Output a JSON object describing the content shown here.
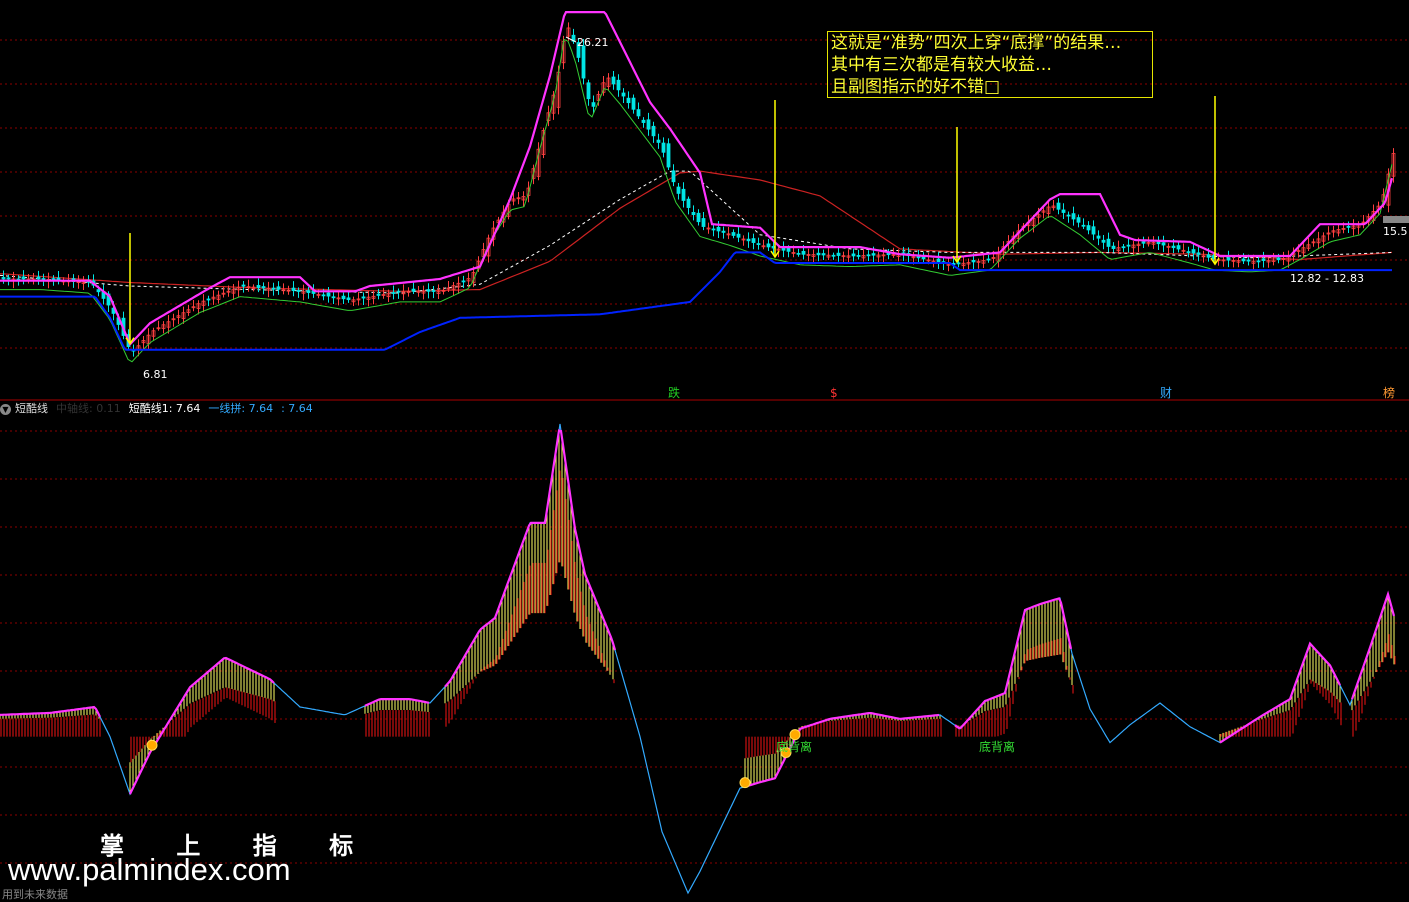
{
  "annotation": {
    "lines": [
      "这就是“准势”四次上穿“底撑”的结果…",
      "其中有三次都是有较大收益…",
      "且副图指示的好不错□"
    ]
  },
  "main_labels": {
    "high_value": "26.21",
    "low_value": "6.81",
    "right_value": "15.5",
    "range_text": "12.82 - 12.83"
  },
  "signals": [
    {
      "text": "跌",
      "color": "#22cc22"
    },
    {
      "text": "$",
      "color": "#ff3333"
    },
    {
      "text": "财",
      "color": "#33aaff"
    },
    {
      "text": "榜",
      "color": "#ff9933"
    }
  ],
  "sub_header": {
    "name": "短酷线",
    "faded": "中轴线: 0.11",
    "line1": "短酷线1: 7.64",
    "line2": "一线拼: 7.64",
    "line3": ": 7.64"
  },
  "sub_labels": {
    "divergence1": "底背离",
    "divergence2": "底背离"
  },
  "watermark": {
    "cn": "掌 上 指 标",
    "url": "www.palmindex.com"
  },
  "footer": "用到未来数据",
  "colors": {
    "background": "#000000",
    "grid": "#8b0000",
    "up": "#ff4040",
    "down": "#00e5e5",
    "band_upper": "#ff33ff",
    "band_lower": "#0022ff",
    "green_line": "#33cc33",
    "red_ma": "#cc2222",
    "white_dash": "#ffffff",
    "arrow": "#ffff00",
    "osc_line": "#33aaff",
    "osc_magenta": "#ff33ff",
    "osc_yellow": "#ffff66",
    "osc_red": "#cc1111"
  },
  "chart_data": [
    {
      "type": "candlestick",
      "title": "",
      "ylim": [
        5.5,
        27
      ],
      "arrows_at_x": [
        130,
        775,
        957,
        1215
      ],
      "close_series": [
        [
          0,
          11.5
        ],
        [
          40,
          11.5
        ],
        [
          90,
          11.3
        ],
        [
          110,
          9.8
        ],
        [
          130,
          7.3
        ],
        [
          150,
          8.5
        ],
        [
          200,
          10.2
        ],
        [
          240,
          11.1
        ],
        [
          300,
          10.8
        ],
        [
          350,
          10.3
        ],
        [
          400,
          10.8
        ],
        [
          440,
          10.8
        ],
        [
          470,
          11.6
        ],
        [
          490,
          14.2
        ],
        [
          510,
          16.0
        ],
        [
          525,
          16.2
        ],
        [
          540,
          19.5
        ],
        [
          555,
          22.5
        ],
        [
          565,
          26.0
        ],
        [
          575,
          24.5
        ],
        [
          590,
          21.0
        ],
        [
          605,
          23.0
        ],
        [
          620,
          22.0
        ],
        [
          640,
          20.5
        ],
        [
          660,
          19.0
        ],
        [
          675,
          16.5
        ],
        [
          700,
          14.5
        ],
        [
          730,
          14.0
        ],
        [
          760,
          13.4
        ],
        [
          800,
          12.9
        ],
        [
          850,
          12.8
        ],
        [
          900,
          12.9
        ],
        [
          950,
          12.3
        ],
        [
          990,
          12.6
        ],
        [
          1020,
          14.4
        ],
        [
          1050,
          15.7
        ],
        [
          1080,
          14.6
        ],
        [
          1110,
          13.2
        ],
        [
          1150,
          13.6
        ],
        [
          1190,
          13.0
        ],
        [
          1215,
          12.6
        ],
        [
          1250,
          12.5
        ],
        [
          1280,
          12.6
        ],
        [
          1300,
          13.2
        ],
        [
          1330,
          14.2
        ],
        [
          1360,
          14.6
        ],
        [
          1380,
          15.8
        ],
        [
          1392,
          18.6
        ]
      ],
      "upper_band": [
        [
          0,
          11.4
        ],
        [
          90,
          11.4
        ],
        [
          110,
          10.5
        ],
        [
          130,
          7.8
        ],
        [
          150,
          9.0
        ],
        [
          210,
          11.0
        ],
        [
          230,
          11.6
        ],
        [
          300,
          11.6
        ],
        [
          315,
          10.8
        ],
        [
          355,
          10.8
        ],
        [
          370,
          11.1
        ],
        [
          440,
          11.5
        ],
        [
          480,
          12.2
        ],
        [
          510,
          16.0
        ],
        [
          530,
          19.0
        ],
        [
          550,
          23.0
        ],
        [
          565,
          26.6
        ],
        [
          605,
          26.6
        ],
        [
          650,
          21.5
        ],
        [
          670,
          20.0
        ],
        [
          700,
          17.5
        ],
        [
          712,
          14.6
        ],
        [
          760,
          14.4
        ],
        [
          780,
          13.3
        ],
        [
          860,
          13.3
        ],
        [
          900,
          12.9
        ],
        [
          950,
          12.7
        ],
        [
          1000,
          13.0
        ],
        [
          1050,
          16.0
        ],
        [
          1060,
          16.3
        ],
        [
          1100,
          16.3
        ],
        [
          1120,
          14.0
        ],
        [
          1135,
          13.7
        ],
        [
          1190,
          13.6
        ],
        [
          1220,
          12.8
        ],
        [
          1290,
          12.8
        ],
        [
          1320,
          14.6
        ],
        [
          1365,
          14.6
        ],
        [
          1385,
          15.8
        ],
        [
          1392,
          17.2
        ]
      ],
      "lower_band": [
        [
          0,
          10.5
        ],
        [
          95,
          10.5
        ],
        [
          110,
          9.3
        ],
        [
          125,
          7.5
        ],
        [
          200,
          7.5
        ],
        [
          385,
          7.5
        ],
        [
          420,
          8.5
        ],
        [
          460,
          9.3
        ],
        [
          600,
          9.5
        ],
        [
          690,
          10.2
        ],
        [
          720,
          11.9
        ],
        [
          735,
          13.0
        ],
        [
          760,
          13.0
        ],
        [
          775,
          12.4
        ],
        [
          950,
          12.4
        ],
        [
          960,
          12.0
        ],
        [
          1215,
          12.0
        ],
        [
          1392,
          12.0
        ]
      ],
      "red_ma": [
        [
          0,
          11.8
        ],
        [
          130,
          11.3
        ],
        [
          250,
          11.0
        ],
        [
          400,
          10.8
        ],
        [
          480,
          10.9
        ],
        [
          550,
          12.5
        ],
        [
          620,
          15.5
        ],
        [
          680,
          17.5
        ],
        [
          700,
          17.6
        ],
        [
          760,
          17.1
        ],
        [
          820,
          16.2
        ],
        [
          900,
          13.2
        ],
        [
          1000,
          12.9
        ],
        [
          1100,
          13.0
        ],
        [
          1200,
          12.9
        ],
        [
          1300,
          12.6
        ],
        [
          1392,
          13.0
        ]
      ],
      "white_dash": [
        [
          0,
          11.7
        ],
        [
          130,
          11.1
        ],
        [
          250,
          10.9
        ],
        [
          400,
          10.7
        ],
        [
          480,
          11.2
        ],
        [
          550,
          13.4
        ],
        [
          620,
          16.0
        ],
        [
          670,
          17.6
        ],
        [
          690,
          17.6
        ],
        [
          760,
          14.0
        ],
        [
          850,
          13.2
        ],
        [
          950,
          13.0
        ],
        [
          1100,
          13.0
        ],
        [
          1250,
          12.7
        ],
        [
          1392,
          13.0
        ]
      ]
    },
    {
      "type": "line",
      "title": "短酷线",
      "ylim": [
        -10,
        14
      ],
      "series": [
        {
          "name": "短酷线1",
          "values": [
            [
              0,
              -0.9
            ],
            [
              50,
              -0.8
            ],
            [
              95,
              -0.5
            ],
            [
              110,
              -2.0
            ],
            [
              130,
              -4.9
            ],
            [
              150,
              -2.8
            ],
            [
              190,
              0.5
            ],
            [
              225,
              2.0
            ],
            [
              270,
              0.9
            ],
            [
              300,
              -0.5
            ],
            [
              345,
              -0.9
            ],
            [
              380,
              -0.1
            ],
            [
              410,
              -0.1
            ],
            [
              430,
              -0.3
            ],
            [
              450,
              0.8
            ],
            [
              480,
              3.4
            ],
            [
              495,
              4.0
            ],
            [
              530,
              8.8
            ],
            [
              545,
              8.8
            ],
            [
              560,
              13.8
            ],
            [
              575,
              8.5
            ],
            [
              585,
              6.2
            ],
            [
              612,
              2.9
            ],
            [
              640,
              -2.0
            ],
            [
              662,
              -6.8
            ],
            [
              688,
              -9.9
            ],
            [
              700,
              -8.8
            ],
            [
              740,
              -4.6
            ],
            [
              760,
              -4.3
            ],
            [
              775,
              -4.1
            ],
            [
              800,
              -1.6
            ],
            [
              830,
              -1.1
            ],
            [
              870,
              -0.8
            ],
            [
              900,
              -1.1
            ],
            [
              940,
              -0.9
            ],
            [
              960,
              -1.6
            ],
            [
              985,
              -0.2
            ],
            [
              1005,
              0.2
            ],
            [
              1025,
              4.4
            ],
            [
              1040,
              4.7
            ],
            [
              1060,
              5.0
            ],
            [
              1072,
              2.2
            ],
            [
              1090,
              -0.6
            ],
            [
              1110,
              -2.3
            ],
            [
              1130,
              -1.4
            ],
            [
              1160,
              -0.3
            ],
            [
              1190,
              -1.5
            ],
            [
              1220,
              -2.3
            ],
            [
              1260,
              -1.0
            ],
            [
              1290,
              -0.1
            ],
            [
              1310,
              2.7
            ],
            [
              1330,
              1.6
            ],
            [
              1350,
              -0.4
            ],
            [
              1370,
              2.5
            ],
            [
              1388,
              5.2
            ],
            [
              1394,
              4.1
            ]
          ]
        }
      ],
      "annotations": [
        "底背离",
        "底背离"
      ],
      "dots_at_x": [
        152,
        745,
        786,
        795
      ]
    }
  ]
}
